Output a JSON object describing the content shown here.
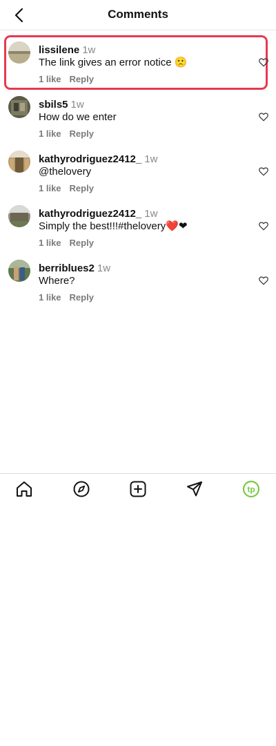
{
  "header": {
    "title": "Comments",
    "back_icon": "chevron-left-icon"
  },
  "comments": [
    {
      "username": "lissilene",
      "time": "1w",
      "text": "The link gives an error notice 🙁",
      "likes": "1 like",
      "reply": "Reply",
      "highlighted": true
    },
    {
      "username": "sbils5",
      "time": "1w",
      "text": "How do we enter",
      "likes": "1 like",
      "reply": "Reply",
      "highlighted": false
    },
    {
      "username": "kathyrodriguez2412_",
      "time": "1w",
      "text": "@thelovery",
      "likes": "1 like",
      "reply": "Reply",
      "highlighted": false
    },
    {
      "username": "kathyrodriguez2412_",
      "time": "1w",
      "text": "Simply the best!!!#thelovery❤️❤",
      "likes": "1 like",
      "reply": "Reply",
      "highlighted": false
    },
    {
      "username": "berriblues2",
      "time": "1w",
      "text": "Where?",
      "likes": "1 like",
      "reply": "Reply",
      "highlighted": false
    }
  ],
  "bottom_nav": {
    "items": [
      "home-icon",
      "explore-compass-icon",
      "create-post-icon",
      "direct-message-icon",
      "profile-avatar-icon"
    ],
    "profile_initials": "tp"
  },
  "colors": {
    "highlight_border": "#e8384f",
    "profile_accent": "#7ac943"
  }
}
